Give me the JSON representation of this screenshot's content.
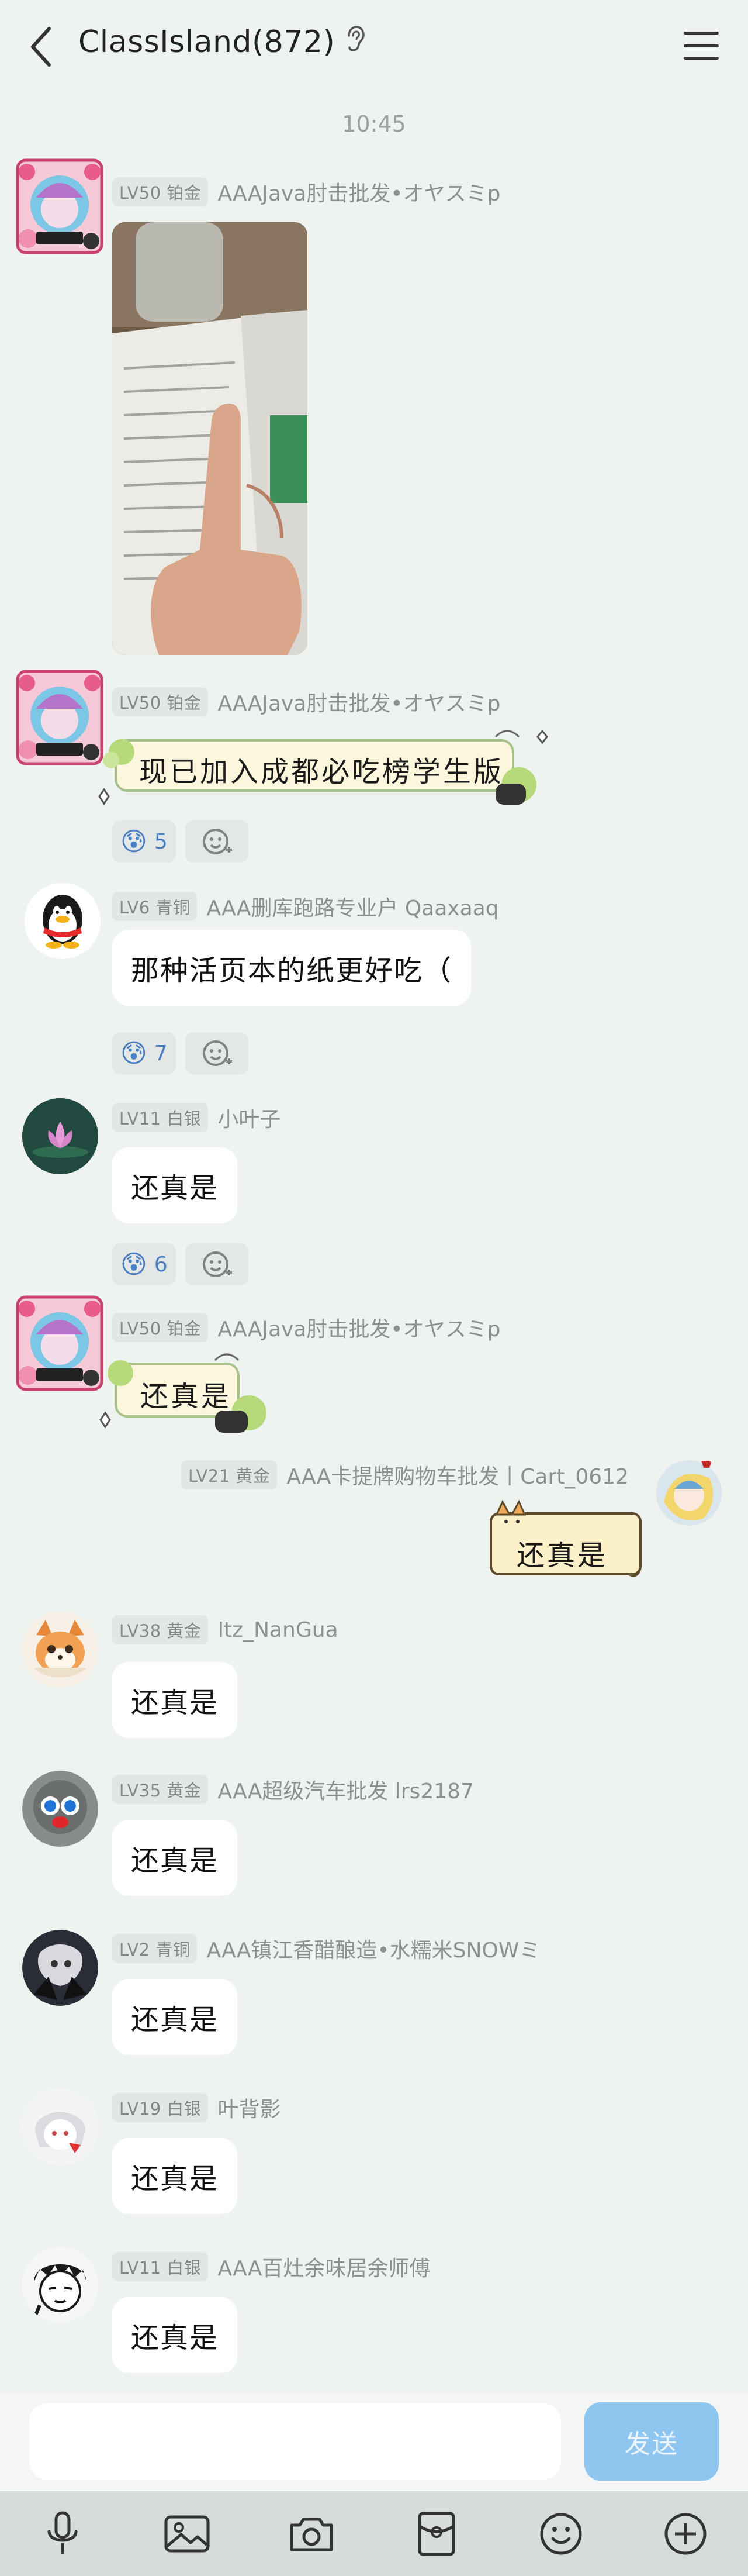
{
  "header": {
    "title": "ClassIsland(872)",
    "back_icon": "back-arrow-icon",
    "ear_icon": "ear-icon",
    "menu_icon": "hamburger-menu-icon"
  },
  "timestamp": "10:45",
  "messages": [
    {
      "level": "LV50 铂金",
      "name": "AAAJava肘击批发•オヤスミp",
      "type": "image"
    },
    {
      "level": "LV50 铂金",
      "name": "AAAJava肘击批发•オヤスミp",
      "text": "现已加入成都必吃榜学生版",
      "reaction_count": "5"
    },
    {
      "level": "LV6 青铜",
      "name": "AAA删库跑路专业户 Qaaxaaq",
      "text": "那种活页本的纸更好吃（",
      "reaction_count": "7"
    },
    {
      "level": "LV11 白银",
      "name": "小叶子",
      "text": "还真是",
      "reaction_count": "6"
    },
    {
      "level": "LV50 铂金",
      "name": "AAAJava肘击批发•オヤスミp",
      "text": "还真是"
    },
    {
      "level": "LV21 黄金",
      "name": "AAA卡提牌购物车批发丨Cart_0612",
      "text": "还真是"
    },
    {
      "level": "LV38 黄金",
      "name": "Itz_NanGua",
      "text": "还真是"
    },
    {
      "level": "LV35 黄金",
      "name": "AAA超级汽车批发 lrs2187",
      "text": "还真是"
    },
    {
      "level": "LV2 青铜",
      "name": "AAA镇江香醋酿造•水糯米SNOWミ",
      "text": "还真是"
    },
    {
      "level": "LV19 白银",
      "name": "叶背影",
      "text": "还真是"
    },
    {
      "level": "LV11 白银",
      "name": "AAA百灶余味居余师傅",
      "text": "还真是"
    }
  ],
  "composer": {
    "input_value": "",
    "send_label": "发送"
  },
  "toolbar": [
    "microphone-icon",
    "image-icon",
    "camera-icon",
    "red-packet-icon",
    "emoji-icon",
    "plus-icon"
  ],
  "colors": {
    "background": "#eef3ef",
    "send_button": "#8fc6ef",
    "reaction_count": "#4a7fc4"
  }
}
